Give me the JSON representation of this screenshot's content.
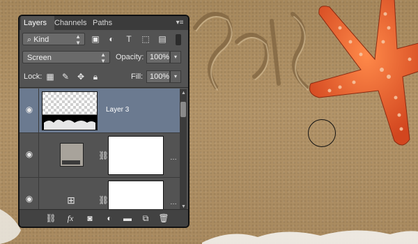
{
  "panel": {
    "tabs": [
      {
        "label": "Layers",
        "active": true
      },
      {
        "label": "Channels",
        "active": false
      },
      {
        "label": "Paths",
        "active": false
      }
    ],
    "menu_icon": "panel-menu-icon",
    "filter": {
      "kind_label": "Kind",
      "icons": [
        "image-filter-icon",
        "adjustment-filter-icon",
        "type-filter-icon",
        "shape-filter-icon",
        "smart-object-filter-icon"
      ]
    },
    "blend_mode": "Screen",
    "opacity_label": "Opacity:",
    "opacity_value": "100%",
    "lock_label": "Lock:",
    "lock_icons": [
      "lock-transparent-icon",
      "lock-image-icon",
      "lock-position-icon",
      "lock-all-icon"
    ],
    "fill_label": "Fill:",
    "fill_value": "100%",
    "layers": [
      {
        "name": "Layer 3",
        "selected": true,
        "type": "pixel"
      },
      {
        "name": "",
        "selected": false,
        "type": "solid-color",
        "thumb_color": "#a8a39b"
      },
      {
        "name": "",
        "selected": false,
        "type": "curves"
      }
    ],
    "bottom_icons": [
      "link-layers-icon",
      "fx-icon",
      "add-mask-icon",
      "new-adjustment-icon",
      "new-group-icon",
      "new-layer-icon",
      "delete-layer-icon"
    ]
  },
  "colors": {
    "panel_bg": "#535353",
    "selected_layer": "#6b7a90",
    "starfish": "#e2542a",
    "sand": "#ac8c60"
  }
}
